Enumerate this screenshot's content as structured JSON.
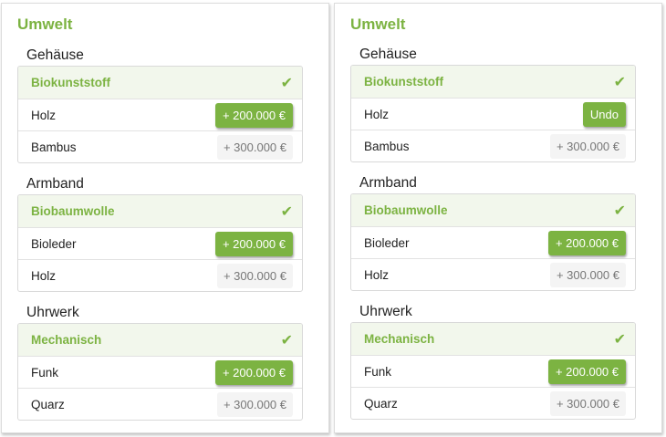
{
  "panels": [
    {
      "title": "Umwelt",
      "sections": [
        {
          "label": "Gehäuse",
          "options": [
            {
              "name": "Biokunststoff",
              "selected": true
            },
            {
              "name": "Holz",
              "price": "+ 200.000 €"
            },
            {
              "name": "Bambus",
              "price": "+ 300.000 €"
            }
          ]
        },
        {
          "label": "Armband",
          "options": [
            {
              "name": "Biobaumwolle",
              "selected": true
            },
            {
              "name": "Bioleder",
              "price": "+ 200.000 €"
            },
            {
              "name": "Holz",
              "price": "+ 300.000 €"
            }
          ]
        },
        {
          "label": "Uhrwerk",
          "options": [
            {
              "name": "Mechanisch",
              "selected": true
            },
            {
              "name": "Funk",
              "price": "+ 200.000 €"
            },
            {
              "name": "Quarz",
              "price": "+ 300.000 €"
            }
          ]
        }
      ]
    },
    {
      "title": "Umwelt",
      "sections": [
        {
          "label": "Gehäuse",
          "options": [
            {
              "name": "Biokunststoff",
              "selected": true
            },
            {
              "name": "Holz",
              "action": "Undo"
            },
            {
              "name": "Bambus",
              "price": "+ 300.000 €"
            }
          ]
        },
        {
          "label": "Armband",
          "options": [
            {
              "name": "Biobaumwolle",
              "selected": true
            },
            {
              "name": "Bioleder",
              "price": "+ 200.000 €"
            },
            {
              "name": "Holz",
              "price": "+ 300.000 €"
            }
          ]
        },
        {
          "label": "Uhrwerk",
          "options": [
            {
              "name": "Mechanisch",
              "selected": true
            },
            {
              "name": "Funk",
              "price": "+ 200.000 €"
            },
            {
              "name": "Quarz",
              "price": "+ 300.000 €"
            }
          ]
        }
      ]
    }
  ],
  "icons": {
    "selected": "check-icon"
  },
  "colors": {
    "accent": "#7cb342",
    "selected_bg": "#f2f7ec",
    "neutral_button": "#f4f4f4"
  }
}
